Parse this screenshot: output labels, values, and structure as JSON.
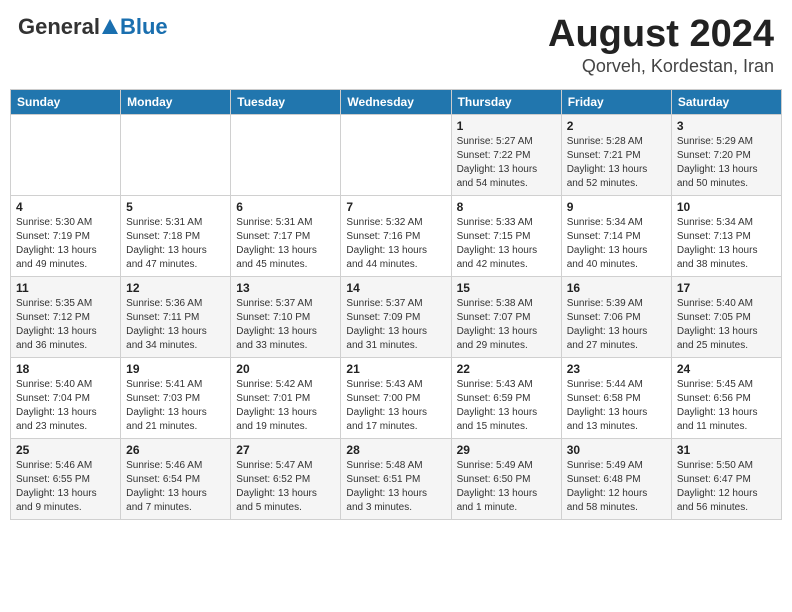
{
  "header": {
    "logo_general": "General",
    "logo_blue": "Blue",
    "title": "August 2024",
    "location": "Qorveh, Kordestan, Iran"
  },
  "calendar": {
    "days_of_week": [
      "Sunday",
      "Monday",
      "Tuesday",
      "Wednesday",
      "Thursday",
      "Friday",
      "Saturday"
    ],
    "weeks": [
      [
        {
          "day": "",
          "info": ""
        },
        {
          "day": "",
          "info": ""
        },
        {
          "day": "",
          "info": ""
        },
        {
          "day": "",
          "info": ""
        },
        {
          "day": "1",
          "info": "Sunrise: 5:27 AM\nSunset: 7:22 PM\nDaylight: 13 hours\nand 54 minutes."
        },
        {
          "day": "2",
          "info": "Sunrise: 5:28 AM\nSunset: 7:21 PM\nDaylight: 13 hours\nand 52 minutes."
        },
        {
          "day": "3",
          "info": "Sunrise: 5:29 AM\nSunset: 7:20 PM\nDaylight: 13 hours\nand 50 minutes."
        }
      ],
      [
        {
          "day": "4",
          "info": "Sunrise: 5:30 AM\nSunset: 7:19 PM\nDaylight: 13 hours\nand 49 minutes."
        },
        {
          "day": "5",
          "info": "Sunrise: 5:31 AM\nSunset: 7:18 PM\nDaylight: 13 hours\nand 47 minutes."
        },
        {
          "day": "6",
          "info": "Sunrise: 5:31 AM\nSunset: 7:17 PM\nDaylight: 13 hours\nand 45 minutes."
        },
        {
          "day": "7",
          "info": "Sunrise: 5:32 AM\nSunset: 7:16 PM\nDaylight: 13 hours\nand 44 minutes."
        },
        {
          "day": "8",
          "info": "Sunrise: 5:33 AM\nSunset: 7:15 PM\nDaylight: 13 hours\nand 42 minutes."
        },
        {
          "day": "9",
          "info": "Sunrise: 5:34 AM\nSunset: 7:14 PM\nDaylight: 13 hours\nand 40 minutes."
        },
        {
          "day": "10",
          "info": "Sunrise: 5:34 AM\nSunset: 7:13 PM\nDaylight: 13 hours\nand 38 minutes."
        }
      ],
      [
        {
          "day": "11",
          "info": "Sunrise: 5:35 AM\nSunset: 7:12 PM\nDaylight: 13 hours\nand 36 minutes."
        },
        {
          "day": "12",
          "info": "Sunrise: 5:36 AM\nSunset: 7:11 PM\nDaylight: 13 hours\nand 34 minutes."
        },
        {
          "day": "13",
          "info": "Sunrise: 5:37 AM\nSunset: 7:10 PM\nDaylight: 13 hours\nand 33 minutes."
        },
        {
          "day": "14",
          "info": "Sunrise: 5:37 AM\nSunset: 7:09 PM\nDaylight: 13 hours\nand 31 minutes."
        },
        {
          "day": "15",
          "info": "Sunrise: 5:38 AM\nSunset: 7:07 PM\nDaylight: 13 hours\nand 29 minutes."
        },
        {
          "day": "16",
          "info": "Sunrise: 5:39 AM\nSunset: 7:06 PM\nDaylight: 13 hours\nand 27 minutes."
        },
        {
          "day": "17",
          "info": "Sunrise: 5:40 AM\nSunset: 7:05 PM\nDaylight: 13 hours\nand 25 minutes."
        }
      ],
      [
        {
          "day": "18",
          "info": "Sunrise: 5:40 AM\nSunset: 7:04 PM\nDaylight: 13 hours\nand 23 minutes."
        },
        {
          "day": "19",
          "info": "Sunrise: 5:41 AM\nSunset: 7:03 PM\nDaylight: 13 hours\nand 21 minutes."
        },
        {
          "day": "20",
          "info": "Sunrise: 5:42 AM\nSunset: 7:01 PM\nDaylight: 13 hours\nand 19 minutes."
        },
        {
          "day": "21",
          "info": "Sunrise: 5:43 AM\nSunset: 7:00 PM\nDaylight: 13 hours\nand 17 minutes."
        },
        {
          "day": "22",
          "info": "Sunrise: 5:43 AM\nSunset: 6:59 PM\nDaylight: 13 hours\nand 15 minutes."
        },
        {
          "day": "23",
          "info": "Sunrise: 5:44 AM\nSunset: 6:58 PM\nDaylight: 13 hours\nand 13 minutes."
        },
        {
          "day": "24",
          "info": "Sunrise: 5:45 AM\nSunset: 6:56 PM\nDaylight: 13 hours\nand 11 minutes."
        }
      ],
      [
        {
          "day": "25",
          "info": "Sunrise: 5:46 AM\nSunset: 6:55 PM\nDaylight: 13 hours\nand 9 minutes."
        },
        {
          "day": "26",
          "info": "Sunrise: 5:46 AM\nSunset: 6:54 PM\nDaylight: 13 hours\nand 7 minutes."
        },
        {
          "day": "27",
          "info": "Sunrise: 5:47 AM\nSunset: 6:52 PM\nDaylight: 13 hours\nand 5 minutes."
        },
        {
          "day": "28",
          "info": "Sunrise: 5:48 AM\nSunset: 6:51 PM\nDaylight: 13 hours\nand 3 minutes."
        },
        {
          "day": "29",
          "info": "Sunrise: 5:49 AM\nSunset: 6:50 PM\nDaylight: 13 hours\nand 1 minute."
        },
        {
          "day": "30",
          "info": "Sunrise: 5:49 AM\nSunset: 6:48 PM\nDaylight: 12 hours\nand 58 minutes."
        },
        {
          "day": "31",
          "info": "Sunrise: 5:50 AM\nSunset: 6:47 PM\nDaylight: 12 hours\nand 56 minutes."
        }
      ]
    ]
  }
}
